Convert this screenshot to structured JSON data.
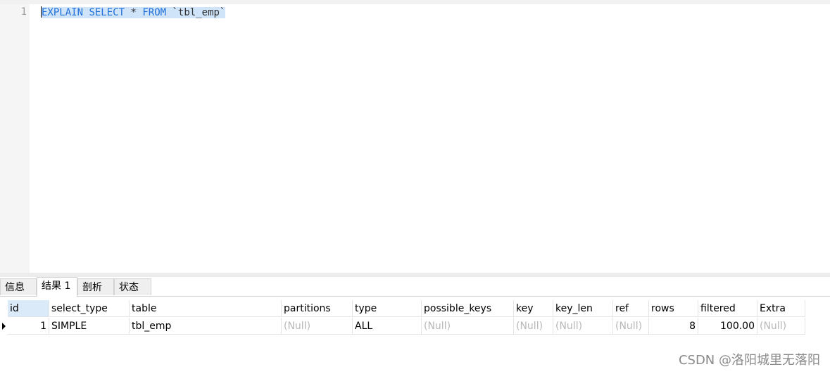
{
  "editor": {
    "line_number": "1",
    "code": {
      "kw_explain": "EXPLAIN",
      "kw_select": "SELECT",
      "star": "*",
      "kw_from": "FROM",
      "table_ident": "`tbl_emp`"
    },
    "selection_color": "#cfe3f9",
    "keyword_color": "#1e6fd9"
  },
  "tabs": [
    {
      "label": "信息",
      "active": false
    },
    {
      "label": "结果 1",
      "active": true
    },
    {
      "label": "剖析",
      "active": false
    },
    {
      "label": "状态",
      "active": false
    }
  ],
  "results": {
    "columns": [
      "id",
      "select_type",
      "table",
      "partitions",
      "type",
      "possible_keys",
      "key",
      "key_len",
      "ref",
      "rows",
      "filtered",
      "Extra"
    ],
    "rows": [
      [
        "1",
        "SIMPLE",
        "tbl_emp",
        "(Null)",
        "ALL",
        "(Null)",
        "(Null)",
        "(Null)",
        "(Null)",
        "8",
        "100.00",
        "(Null)"
      ]
    ]
  },
  "watermark": "CSDN @洛阳城里无落阳"
}
